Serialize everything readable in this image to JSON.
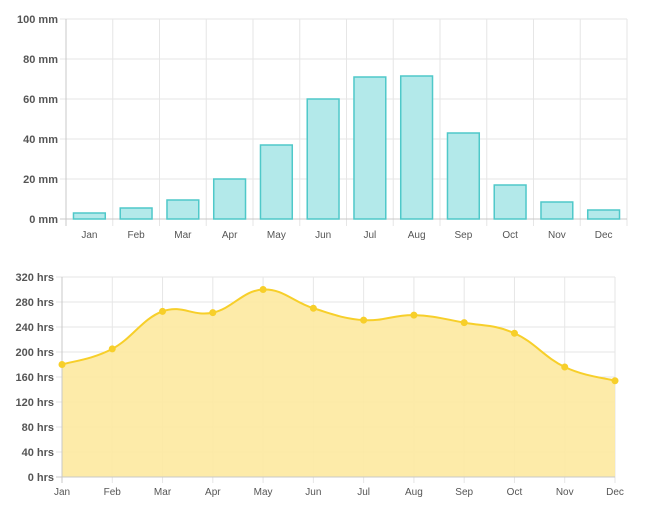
{
  "chart_data": [
    {
      "type": "bar",
      "categories": [
        "Jan",
        "Feb",
        "Mar",
        "Apr",
        "May",
        "Jun",
        "Jul",
        "Aug",
        "Sep",
        "Oct",
        "Nov",
        "Dec"
      ],
      "values": [
        3,
        5.5,
        9.5,
        20,
        37,
        60,
        71,
        71.5,
        43,
        17,
        8.5,
        4.5
      ],
      "ylim": [
        0,
        100
      ],
      "yticks": [
        "0 mm",
        "20 mm",
        "40 mm",
        "60 mm",
        "80 mm",
        "100 mm"
      ],
      "grid": true,
      "colors": {
        "fill": "#b3e9ea",
        "stroke": "#4fc8c9"
      }
    },
    {
      "type": "area",
      "categories": [
        "Jan",
        "Feb",
        "Mar",
        "Apr",
        "May",
        "Jun",
        "Jul",
        "Aug",
        "Sep",
        "Oct",
        "Nov",
        "Dec"
      ],
      "values": [
        180,
        205,
        265,
        263,
        300,
        270,
        251,
        259,
        247,
        230,
        176,
        154
      ],
      "ylim": [
        0,
        320
      ],
      "yticks": [
        "0 hrs",
        "40 hrs",
        "80 hrs",
        "120 hrs",
        "160 hrs",
        "200 hrs",
        "240 hrs",
        "280 hrs",
        "320 hrs"
      ],
      "grid": true,
      "colors": {
        "fill": "#fde9a0",
        "stroke": "#f7cf2a",
        "point": "#f7cf2a"
      }
    }
  ]
}
